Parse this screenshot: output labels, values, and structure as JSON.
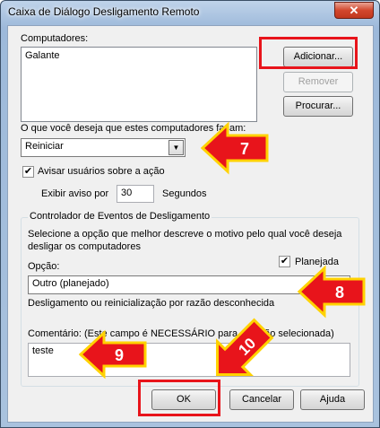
{
  "window": {
    "title": "Caixa de Diálogo Desligamento Remoto",
    "close_glyph": "✕"
  },
  "computers": {
    "label": "Computadores:",
    "items": [
      "Galante"
    ],
    "add_button": "Adicionar...",
    "remove_button": "Remover",
    "browse_button": "Procurar..."
  },
  "action": {
    "label": "O que você deseja que estes computadores façam:",
    "selected": "Reiniciar"
  },
  "warn": {
    "checkbox_label": "Avisar usuários sobre a ação",
    "checked": true,
    "show_label": "Exibir aviso por",
    "seconds_value": "30",
    "seconds_unit": "Segundos"
  },
  "tracker": {
    "group_title": "Controlador de Eventos de Desligamento",
    "description": "Selecione a opção que melhor descreve o motivo pelo qual você deseja desligar os computadores",
    "option_label": "Opção:",
    "planned_label": "Planejada",
    "planned_checked": true,
    "option_selected": "Outro (planejado)",
    "option_description": "Desligamento ou reinicialização por razão desconhecida",
    "comment_label": "Comentário: (Este campo é NECESSÁRIO para a opção selecionada)",
    "comment_value": "teste"
  },
  "buttons": {
    "ok": "OK",
    "cancel": "Cancelar",
    "help": "Ajuda"
  },
  "annotations": {
    "step7": "7",
    "step8": "8",
    "step9": "9",
    "step10": "10"
  },
  "colors": {
    "highlight": "#e8141b",
    "arrow_fill": "#e8141b",
    "arrow_stroke": "#ffd200"
  }
}
